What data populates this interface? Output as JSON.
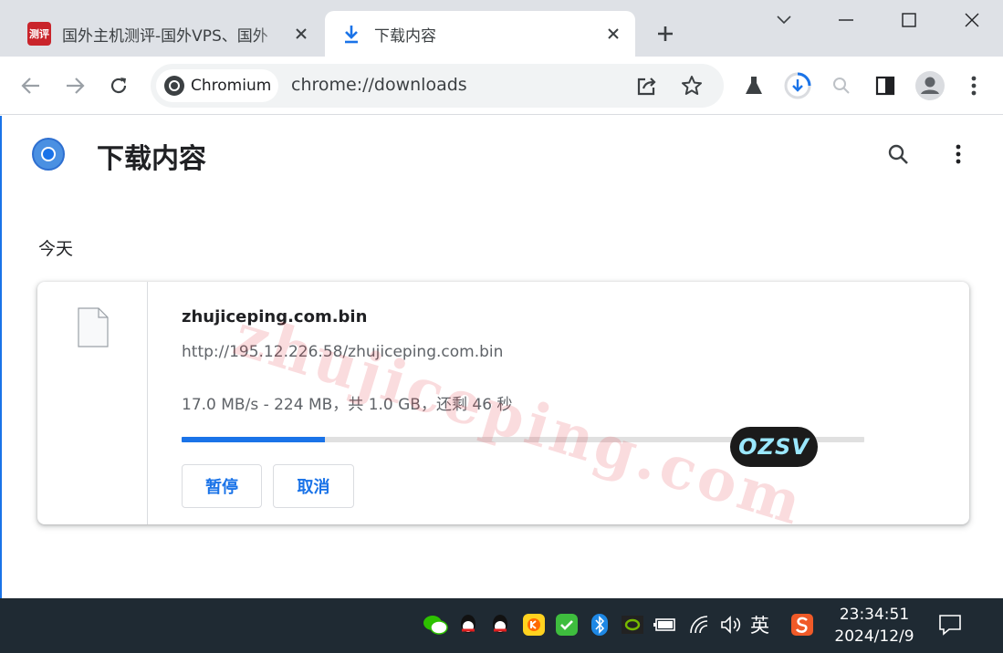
{
  "tabs": [
    {
      "title": "国外主机测评-国外VPS、国外",
      "favicon": "site-logo-icon",
      "favicon_text": "测评",
      "active": false
    },
    {
      "title": "下载内容",
      "favicon": "download-icon",
      "active": true
    }
  ],
  "toolbar": {
    "chip_label": "Chromium",
    "url": "chrome://downloads"
  },
  "page": {
    "title": "下载内容",
    "section_date": "今天"
  },
  "download": {
    "file_name": "zhujiceping.com.bin",
    "url": "http://195.12.226.58/zhujiceping.com.bin",
    "progress_text": "17.0 MB/s - 224 MB，共 1.0 GB，还剩 46 秒",
    "progress_fraction": 0.21,
    "pause_label": "暂停",
    "cancel_label": "取消"
  },
  "watermark": {
    "text": "zhujiceping.com",
    "stamp": "OZSV"
  },
  "taskbar": {
    "ime_label": "英",
    "time": "23:34:51",
    "date": "2024/12/9",
    "tray_icons": [
      "wechat-icon",
      "qq-icon",
      "qq-icon",
      "k-app-icon",
      "checkmark-app-icon",
      "bluetooth-icon",
      "nvidia-icon",
      "battery-icon",
      "wifi-icon",
      "volume-icon",
      "sogou-icon"
    ]
  },
  "colors": {
    "accent": "#1a73e8",
    "tabstrip": "#dee1e6",
    "taskbar": "#1f2a33"
  }
}
